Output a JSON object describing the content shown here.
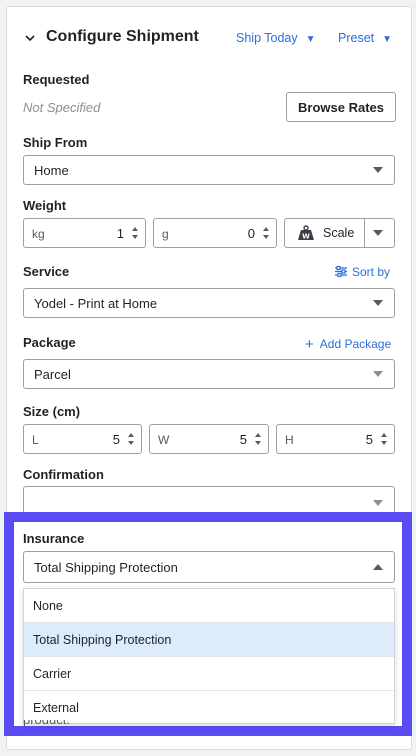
{
  "header": {
    "title": "Configure Shipment",
    "ship_today": "Ship Today",
    "preset": "Preset"
  },
  "requested": {
    "label": "Requested",
    "value": "Not Specified",
    "browse_rates": "Browse Rates"
  },
  "ship_from": {
    "label": "Ship From",
    "value": "Home"
  },
  "weight": {
    "label": "Weight",
    "kg_unit": "kg",
    "kg_value": "1",
    "g_unit": "g",
    "g_value": "0",
    "scale_label": "Scale",
    "scale_icon_letter": "W"
  },
  "service": {
    "label": "Service",
    "sort_by": "Sort by",
    "value": "Yodel - Print at Home"
  },
  "package": {
    "label": "Package",
    "add_package": "Add Package",
    "value": "Parcel"
  },
  "size": {
    "label": "Size (cm)",
    "l_unit": "L",
    "l_value": "5",
    "w_unit": "W",
    "w_value": "5",
    "h_unit": "H",
    "h_value": "5"
  },
  "confirmation": {
    "label": "Confirmation",
    "value": ""
  },
  "insurance": {
    "label": "Insurance",
    "value": "Total Shipping Protection",
    "options": [
      "None",
      "Total Shipping Protection",
      "Carrier",
      "External"
    ],
    "selected_index": 1
  },
  "behind_text": "product.",
  "colors": {
    "accent": "#2a6fdb",
    "highlight": "#5b4bf5",
    "selected_row": "#dcecf8"
  },
  "icons": {
    "collapse": "chevron-down-icon",
    "caret": "caret-down-icon",
    "scale": "scale-weight-icon",
    "sort": "sliders-icon",
    "add": "plus-icon",
    "spinner": "stepper-arrows-icon"
  }
}
